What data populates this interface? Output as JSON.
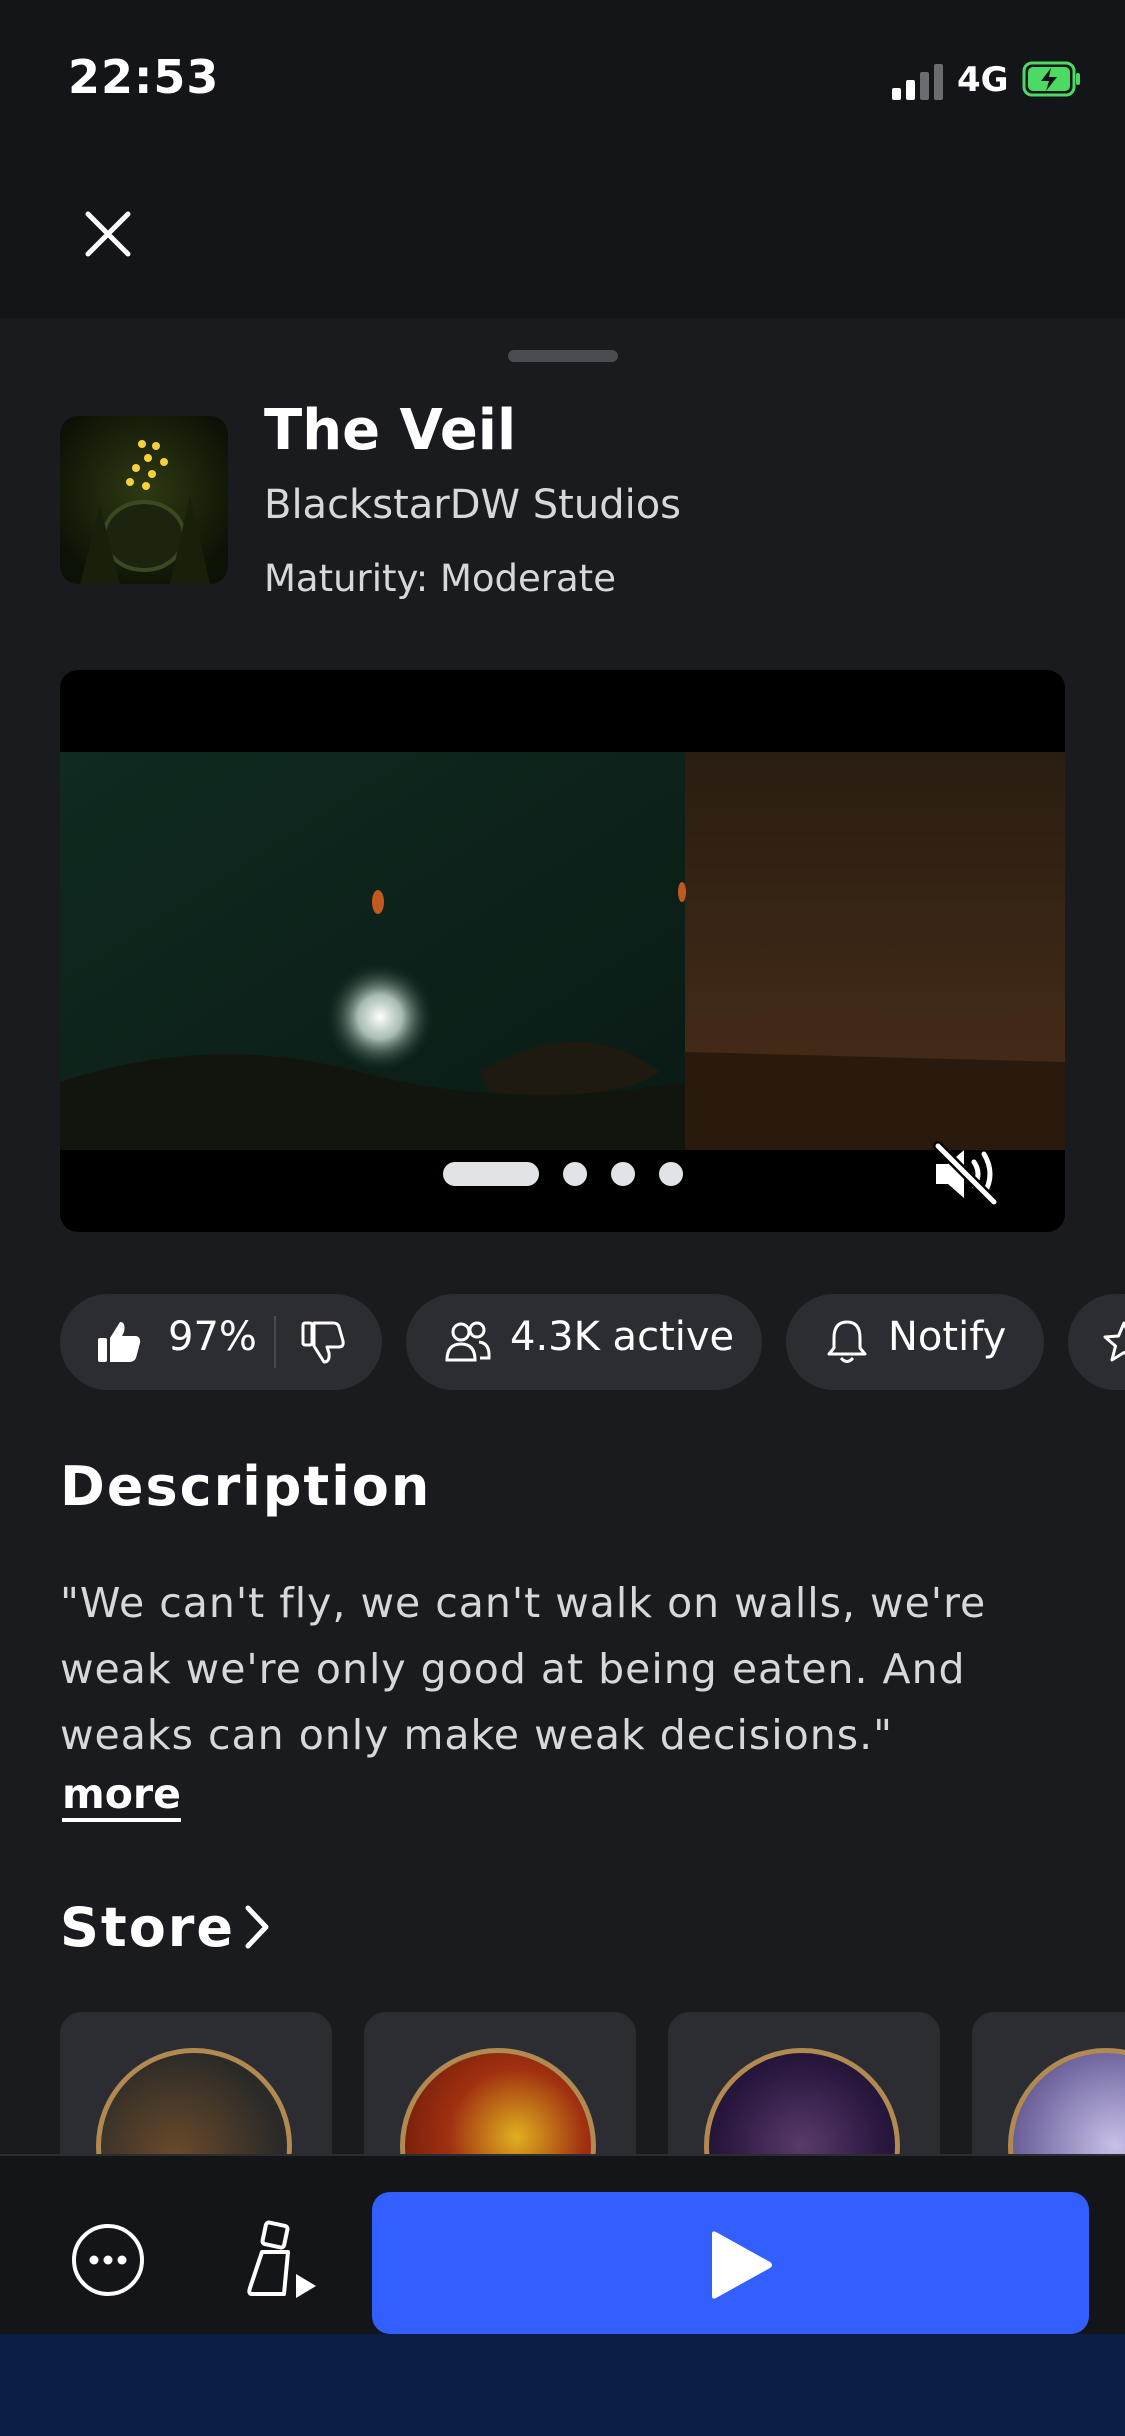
{
  "status_bar": {
    "time": "22:53",
    "network": "4G",
    "signal_bars": 2,
    "battery_charging": true
  },
  "game": {
    "title": "The Veil",
    "creator": "BlackstarDW Studios",
    "maturity": "Maturity: Moderate"
  },
  "media": {
    "slide_count": 4,
    "active_slide": 1,
    "muted": true
  },
  "stats": {
    "rating": "97%",
    "active_players": "4.3K active",
    "notify_label": "Notify"
  },
  "description": {
    "heading": "Description",
    "text": "\"We can't fly, we can't walk on walls, we're weak we're only good at being eaten. And weaks can only make weak decisions.\"",
    "more_label": "more"
  },
  "store": {
    "heading": "Store"
  },
  "colors": {
    "background": "#1a1b1f",
    "pill": "#2c2d32",
    "play_button": "#335fff",
    "home_indicator_area": "#0a1f45"
  },
  "icons": [
    "close-icon",
    "thumbs-up-icon",
    "thumbs-down-icon",
    "people-icon",
    "bell-icon",
    "star-icon",
    "mute-icon",
    "chevron-right-icon",
    "more-icon",
    "party-icon",
    "play-icon"
  ]
}
